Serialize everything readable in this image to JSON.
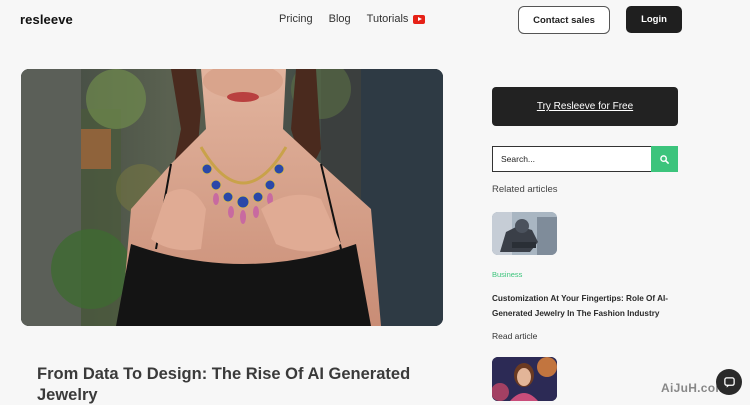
{
  "header": {
    "logo": "resleeve",
    "nav": [
      {
        "label": "Pricing"
      },
      {
        "label": "Blog"
      },
      {
        "label": "Tutorials",
        "icon": "youtube-icon"
      }
    ],
    "contact_label": "Contact sales",
    "login_label": "Login"
  },
  "hero": {
    "image": "woman-wearing-gemstone-necklace-photo"
  },
  "article": {
    "title": "From Data To Design: The Rise Of AI Generated Jewelry"
  },
  "sidebar": {
    "cta_label": "Try Resleeve for Free",
    "search_placeholder": "Search...",
    "search_icon": "search-icon",
    "related_heading": "Related articles",
    "related": [
      {
        "image": "robot-jewelry-thumbnail",
        "category": "Business",
        "title": "Customization At Your Fingertips: Role Of AI-Generated Jewelry In The Fashion Industry",
        "read_label": "Read article"
      },
      {
        "image": "woman-portrait-thumbnail"
      }
    ]
  },
  "overlay": {
    "watermark": "AiJuH.com",
    "chat_icon": "chat-icon"
  },
  "colors": {
    "accent_green": "#3cc47c",
    "dark": "#222222",
    "youtube_red": "#e62117"
  }
}
